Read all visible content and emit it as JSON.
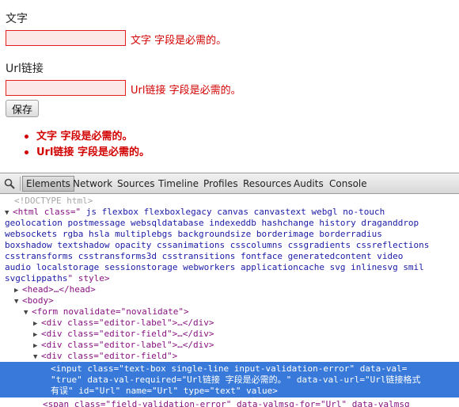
{
  "form": {
    "label_text": "文字",
    "label_url": "Url链接",
    "error_text": "文字 字段是必需的。",
    "error_url": "Url链接 字段是必需的。",
    "save_label": "保存",
    "summary": [
      "文字 字段是必需的。",
      "Url链接 字段是必需的。"
    ]
  },
  "devtools": {
    "tabs": [
      "Elements",
      "Network",
      "Sources",
      "Timeline",
      "Profiles",
      "Resources",
      "Audits",
      "Console"
    ],
    "active_tab": "Elements",
    "icon": "search-icon",
    "lines": {
      "doctype": "<!DOCTYPE html>",
      "html_open": "<html class=\"",
      "html_classes": [
        " js flexbox flexboxlegacy canvas canvastext webgl no-touch",
        "geolocation postmessage websqldatabase indexeddb hashchange history draganddrop",
        "websockets rgba hsla multiplebgs backgroundsize borderimage borderradius",
        "boxshadow textshadow opacity cssanimations csscolumns cssgradients cssreflections",
        "csstransforms csstransforms3d csstransitions fontface generatedcontent video",
        "audio localstorage sessionstorage webworkers applicationcache svg inlinesvg smil",
        "svgclippaths"
      ],
      "html_close": "\" style>",
      "head": "<head>…</head>",
      "body": "<body>",
      "form": "<form novalidate=\"novalidate\">",
      "div_label_1": "<div class=\"editor-label\">…</div>",
      "div_field_1": "<div class=\"editor-field\">…</div>",
      "div_label_2": "<div class=\"editor-label\">…</div>",
      "div_field_2": "<div class=\"editor-field\">",
      "selected": [
        "<input class=\"text-box single-line input-validation-error\" data-val=",
        "\"true\" data-val-required=\"Url链接 字段是必需的。\" data-val-url=\"Url链接格式",
        "有误\" id=\"Url\" name=\"Url\" type=\"text\" value>"
      ],
      "partial": "<span class=\"field-validation-error\" data-valmsg-for=\"Url\" data-valmsg"
    }
  },
  "colors": {
    "error": "#d20000",
    "error_bg": "#fde8e8",
    "selection": "#3879d9",
    "tag": "#881280",
    "attr": "#994500",
    "value": "#1a1aa6"
  }
}
